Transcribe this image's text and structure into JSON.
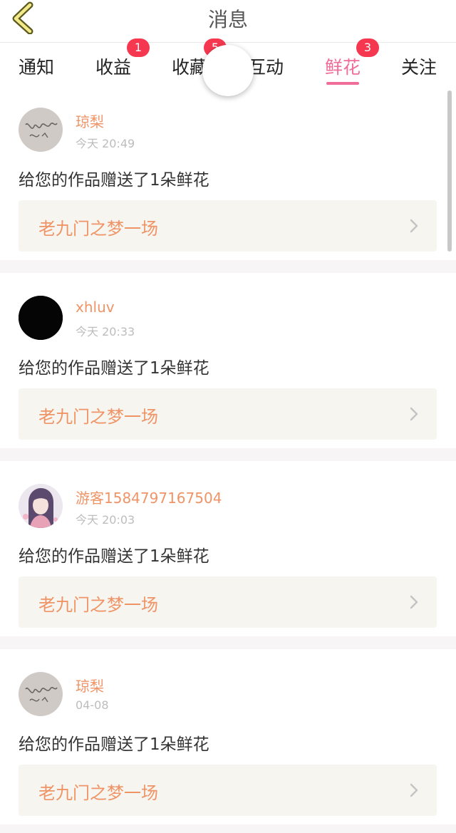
{
  "header": {
    "title": "消息"
  },
  "tabs": [
    {
      "label": "通知",
      "badge": ""
    },
    {
      "label": "收益",
      "badge": "1"
    },
    {
      "label": "收藏",
      "badge": "5"
    },
    {
      "label": "互动",
      "badge": ""
    },
    {
      "label": "鲜花",
      "badge": "3",
      "active": true
    },
    {
      "label": "关注",
      "badge": ""
    }
  ],
  "colors": {
    "accent": "#ef6d98",
    "badge": "#f5384f",
    "username": "#ef9467",
    "card_bg": "#f6f5ef"
  },
  "messages": [
    {
      "username": "琼梨",
      "time": "今天 20:49",
      "text": "给您的作品赠送了1朵鲜花",
      "work_title": "老九门之梦一场",
      "avatar": "handwriting-avatar"
    },
    {
      "username": "xhluv",
      "time": "今天 20:33",
      "text": "给您的作品赠送了1朵鲜花",
      "work_title": "老九门之梦一场",
      "avatar": "black-avatar"
    },
    {
      "username": "游客1584797167504",
      "time": "今天 20:03",
      "text": "给您的作品赠送了1朵鲜花",
      "work_title": "老九门之梦一场",
      "avatar": "anime-girl-avatar"
    },
    {
      "username": "琼梨",
      "time": "04-08",
      "text": "给您的作品赠送了1朵鲜花",
      "work_title": "老九门之梦一场",
      "avatar": "handwriting-avatar"
    }
  ]
}
